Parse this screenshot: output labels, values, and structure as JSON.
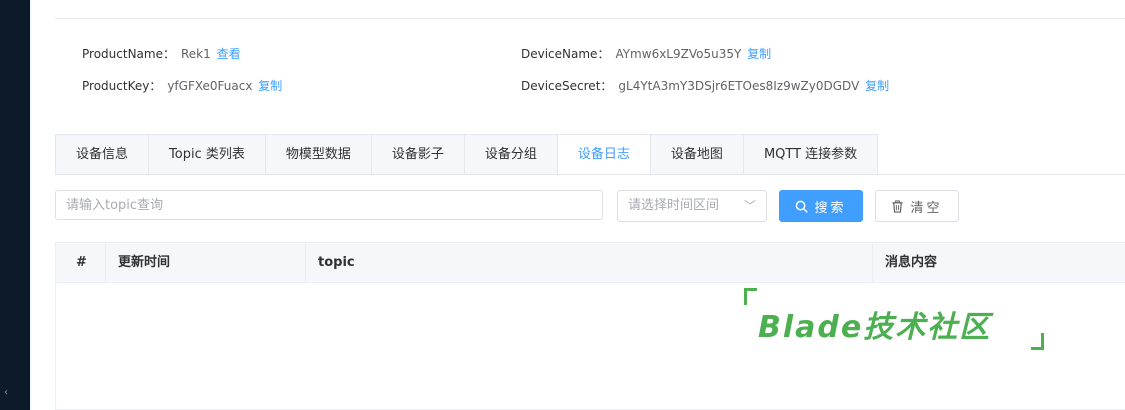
{
  "device_info": {
    "product_name_label": "ProductName：",
    "product_name_value": "Rek1",
    "product_name_link": "查看",
    "device_name_label": "DeviceName：",
    "device_name_value": "AYmw6xL9ZVo5u35Y",
    "device_name_link": "复制",
    "product_key_label": "ProductKey：",
    "product_key_value": "yfGFXe0Fuacx",
    "product_key_link": "复制",
    "device_secret_label": "DeviceSecret：",
    "device_secret_value": "gL4YtA3mY3DSjr6ETOes8Iz9wZy0DGDV",
    "device_secret_link": "复制"
  },
  "tabs": [
    {
      "label": "设备信息",
      "active": false
    },
    {
      "label": "Topic 类列表",
      "active": false
    },
    {
      "label": "物模型数据",
      "active": false
    },
    {
      "label": "设备影子",
      "active": false
    },
    {
      "label": "设备分组",
      "active": false
    },
    {
      "label": "设备日志",
      "active": true
    },
    {
      "label": "设备地图",
      "active": false
    },
    {
      "label": "MQTT 连接参数",
      "active": false
    }
  ],
  "filters": {
    "topic_placeholder": "请输入topic查询",
    "topic_value": "",
    "date_placeholder": "请选择时间区间"
  },
  "buttons": {
    "search_label": "搜索",
    "clear_label": "清空"
  },
  "table": {
    "columns": [
      "#",
      "更新时间",
      "topic",
      "消息内容"
    ],
    "rows": []
  },
  "watermark": {
    "text": "Blade技术社区"
  },
  "colors": {
    "accent": "#409eff",
    "watermark": "#4caf50",
    "sidebar": "#0c1a2a"
  },
  "icons": {
    "search": "search-icon",
    "clear": "trash-icon",
    "select": "chevron-down-icon"
  }
}
